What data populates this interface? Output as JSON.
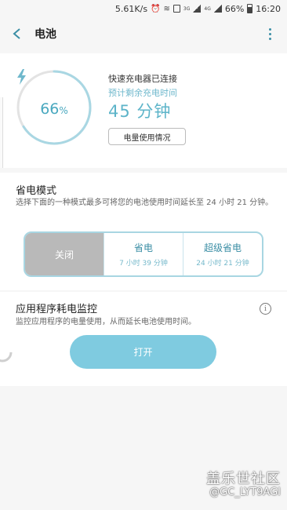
{
  "status_bar": {
    "speed": "5.61K/s",
    "battery": "66%",
    "time": "16:20",
    "network_a": "3G",
    "network_b": "4G"
  },
  "app_bar": {
    "title": "电池"
  },
  "battery": {
    "level_percent": 66,
    "level_number": "66",
    "level_unit": "%",
    "charger_status": "快速充电器已连接",
    "remaining_label": "预计剩余充电时间",
    "remaining_time": "45 分钟",
    "usage_button": "电量使用情况",
    "ring_color": "#a9d7e3",
    "accent_color": "#49a8bf"
  },
  "power_mode": {
    "title": "省电模式",
    "description": "选择下面的一种模式最多可将您的电池使用时间延长至 24 小时 21 分钟。",
    "options": [
      {
        "label": "关闭",
        "sub": "",
        "selected": true
      },
      {
        "label": "省电",
        "sub": "7 小时 39 分钟",
        "selected": false
      },
      {
        "label": "超级省电",
        "sub": "24 小时 21 分钟",
        "selected": false
      }
    ]
  },
  "app_monitor": {
    "title": "应用程序耗电监控",
    "description": "监控应用程序的电量使用，从而延长电池使用时间。",
    "button": "打开"
  },
  "watermark": {
    "site": "盖乐世社区",
    "user": "@GC_LYT9AGI"
  }
}
